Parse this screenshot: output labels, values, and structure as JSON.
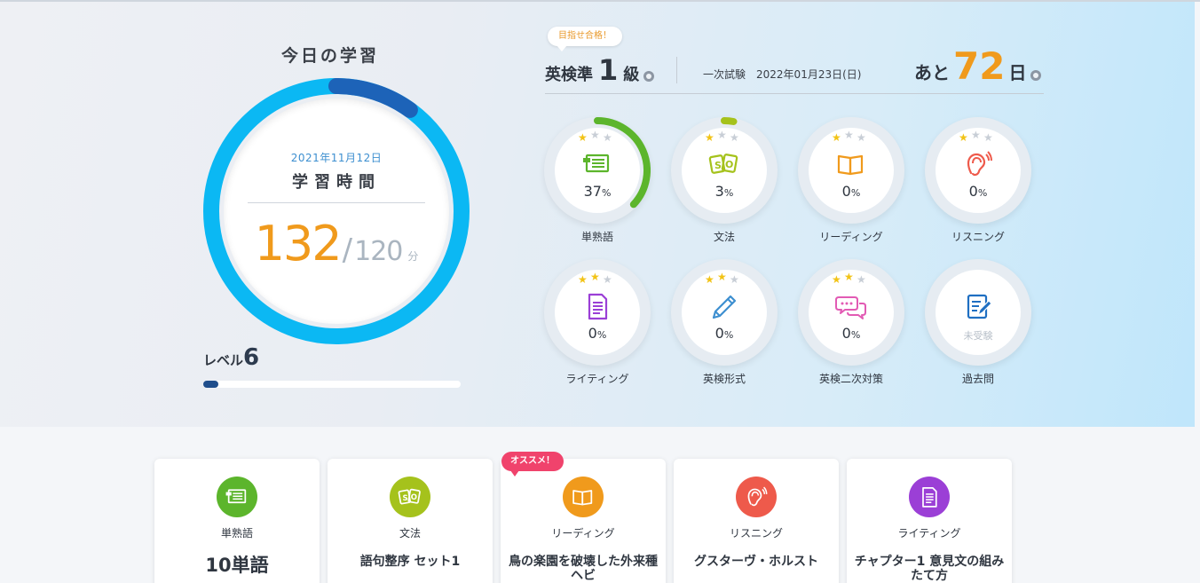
{
  "today": {
    "title": "今日の学習",
    "date": "2021年11月12日",
    "label": "学習時間",
    "current": "132",
    "separator": "/",
    "goal": "120",
    "unit": "分",
    "progress": 1.1
  },
  "level": {
    "prefix": "レベル",
    "value": "6",
    "progress": 0.06
  },
  "exam": {
    "badge": "目指せ合格！",
    "grade_prefix": "英検準",
    "grade_num": "1",
    "grade_suffix": "級",
    "type": "一次試験",
    "date": "2022年01月23日(日)",
    "remain_prefix": "あと",
    "remain_days": "72",
    "remain_suffix": "日"
  },
  "skills": [
    {
      "name": "単熟語",
      "pct": "37",
      "unit": "%",
      "progress": 0.37,
      "stars": 1,
      "color": "#5cb52c",
      "icon": "vocab-icon"
    },
    {
      "name": "文法",
      "pct": "3",
      "unit": "%",
      "progress": 0.03,
      "stars": 1,
      "color": "#a5c21c",
      "icon": "grammar-icon"
    },
    {
      "name": "リーディング",
      "pct": "0",
      "unit": "%",
      "progress": 0,
      "stars": 1,
      "color": "#f09a1c",
      "icon": "book-icon"
    },
    {
      "name": "リスニング",
      "pct": "0",
      "unit": "%",
      "progress": 0,
      "stars": 1,
      "color": "#ee5a4b",
      "icon": "ear-icon"
    },
    {
      "name": "ライティング",
      "pct": "0",
      "unit": "%",
      "progress": 0,
      "stars": 2,
      "color": "#9b3fd6",
      "icon": "document-icon"
    },
    {
      "name": "英検形式",
      "pct": "0",
      "unit": "%",
      "progress": 0,
      "stars": 2,
      "color": "#3d8fd0",
      "icon": "pencil-icon"
    },
    {
      "name": "英検二次対策",
      "pct": "0",
      "unit": "%",
      "progress": 0,
      "stars": 2,
      "color": "#e25bb4",
      "icon": "speech-icon"
    },
    {
      "name": "過去問",
      "pct": "未受験",
      "unit": "",
      "progress": 0,
      "stars": 0,
      "color": "#1f6fc2",
      "icon": "exam-paper-icon"
    }
  ],
  "recommend_badge": "オススメ！",
  "cards": [
    {
      "title": "単熟語",
      "body": "10単語",
      "color": "#5cb52c",
      "icon": "vocab-icon"
    },
    {
      "title": "文法",
      "body": "語句整序 セット1",
      "color": "#a5c21c",
      "icon": "grammar-icon"
    },
    {
      "title": "リーディング",
      "body": "鳥の楽園を破壊した外来種ヘビ",
      "color": "#f09a1c",
      "icon": "book-icon"
    },
    {
      "title": "リスニング",
      "body": "グスターヴ・ホルスト",
      "color": "#ee5a4b",
      "icon": "ear-icon"
    },
    {
      "title": "ライティング",
      "body": "チャプター1 意見文の組みたて方",
      "color": "#9b3fd6",
      "icon": "document-icon"
    }
  ]
}
